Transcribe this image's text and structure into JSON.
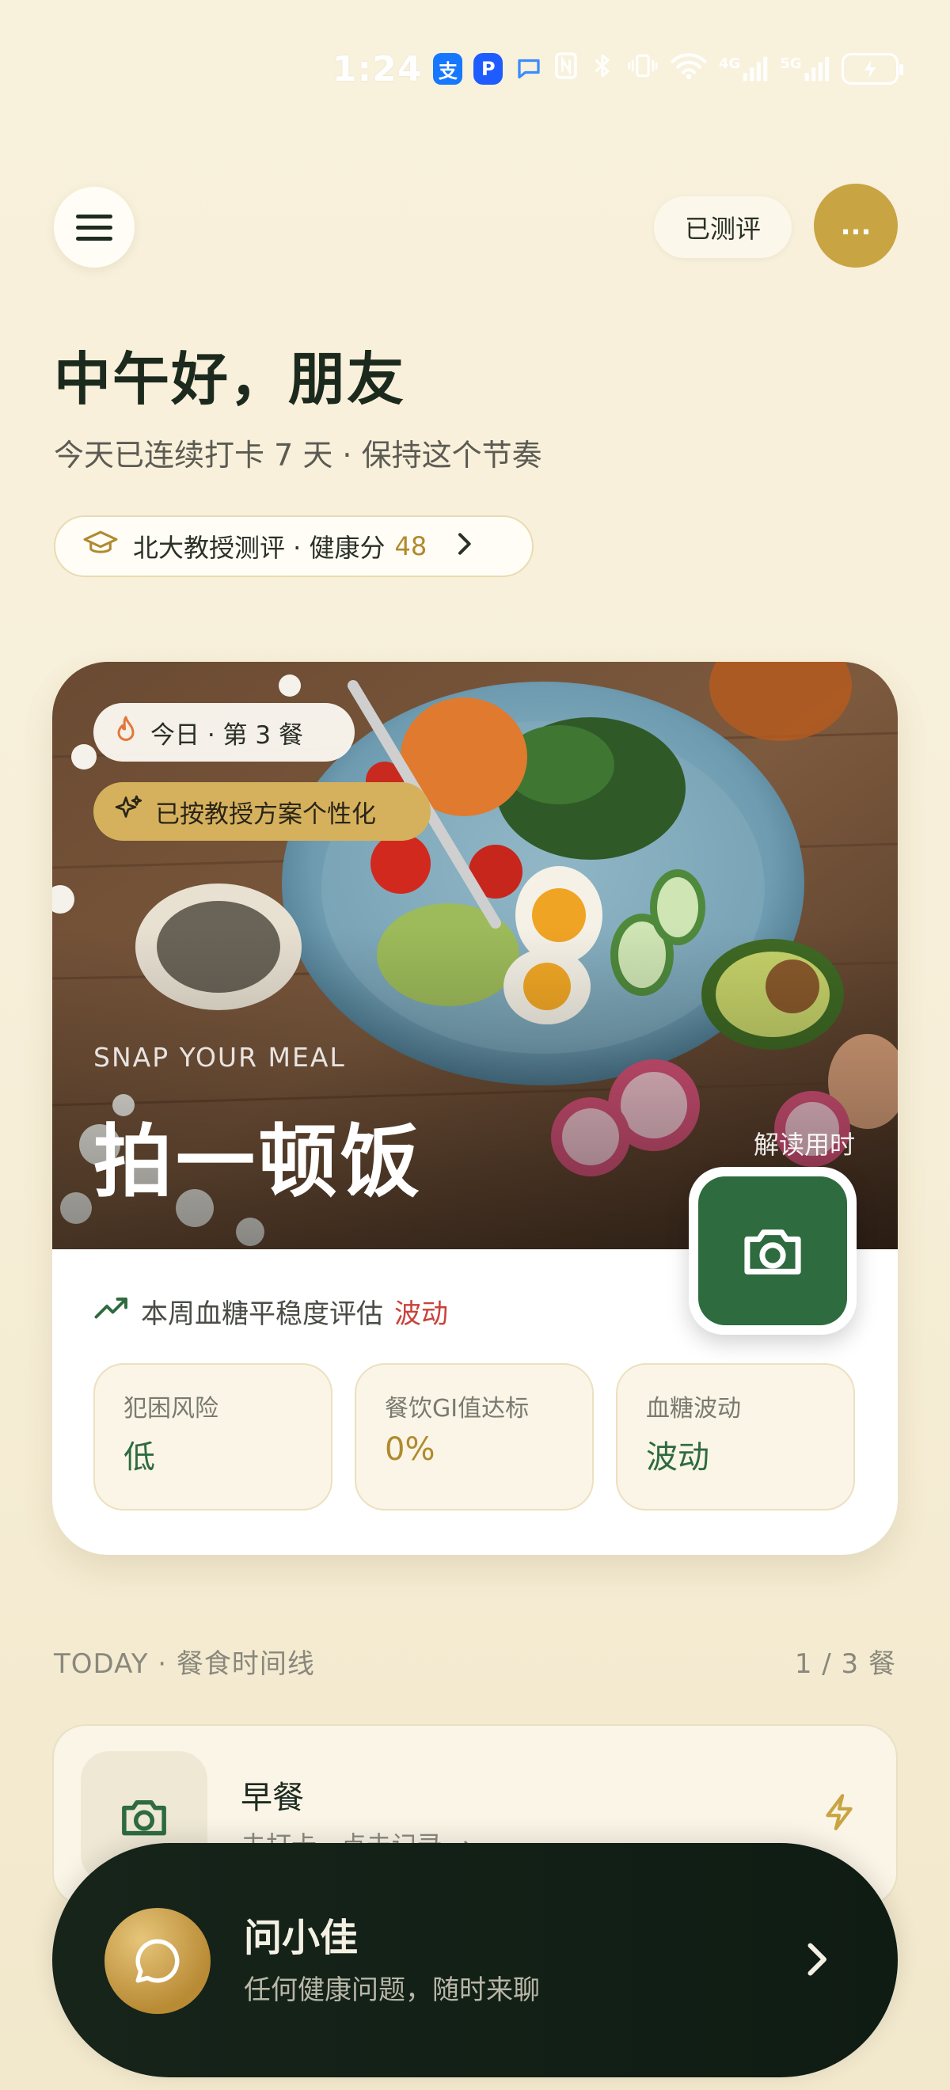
{
  "status_bar": {
    "time": "1:24",
    "apps": [
      "支",
      "P",
      "Q"
    ],
    "network_labels": [
      "4G",
      "5G"
    ]
  },
  "header": {
    "assessed_label": "已测评",
    "avatar_label": "..."
  },
  "greeting": {
    "title": "中午好，朋友",
    "streak": "今天已连续打卡 7 天 · 保持这个节奏"
  },
  "professor_pill": {
    "label": "北大教授测评 · 健康分",
    "score": "48"
  },
  "hero": {
    "chip_today": "今日 · 第 3 餐",
    "chip_personalized": "已按教授方案个性化",
    "subtitle": "SNAP YOUR MEAL",
    "title": "拍一顿饭",
    "decode_label": "解读用时"
  },
  "glucose": {
    "label": "本周血糖平稳度评估",
    "status": "波动",
    "status_color": "#c9423a"
  },
  "metrics": [
    {
      "label": "犯困风险",
      "value": "低"
    },
    {
      "label": "餐饮GI值达标",
      "value": "0%"
    },
    {
      "label": "血糖波动",
      "value": "波动"
    }
  ],
  "timeline": {
    "heading": "TODAY · 餐食时间线",
    "count": "1 / 3 餐",
    "meals": [
      {
        "title": "早餐",
        "subtitle": "未打卡 · 点击记录 →"
      }
    ]
  },
  "chat": {
    "title": "问小佳",
    "subtitle": "任何健康问题，随时来聊"
  },
  "colors": {
    "accent_green": "#2e6b3f",
    "accent_gold": "#c9a443",
    "warning_red": "#c9423a"
  }
}
